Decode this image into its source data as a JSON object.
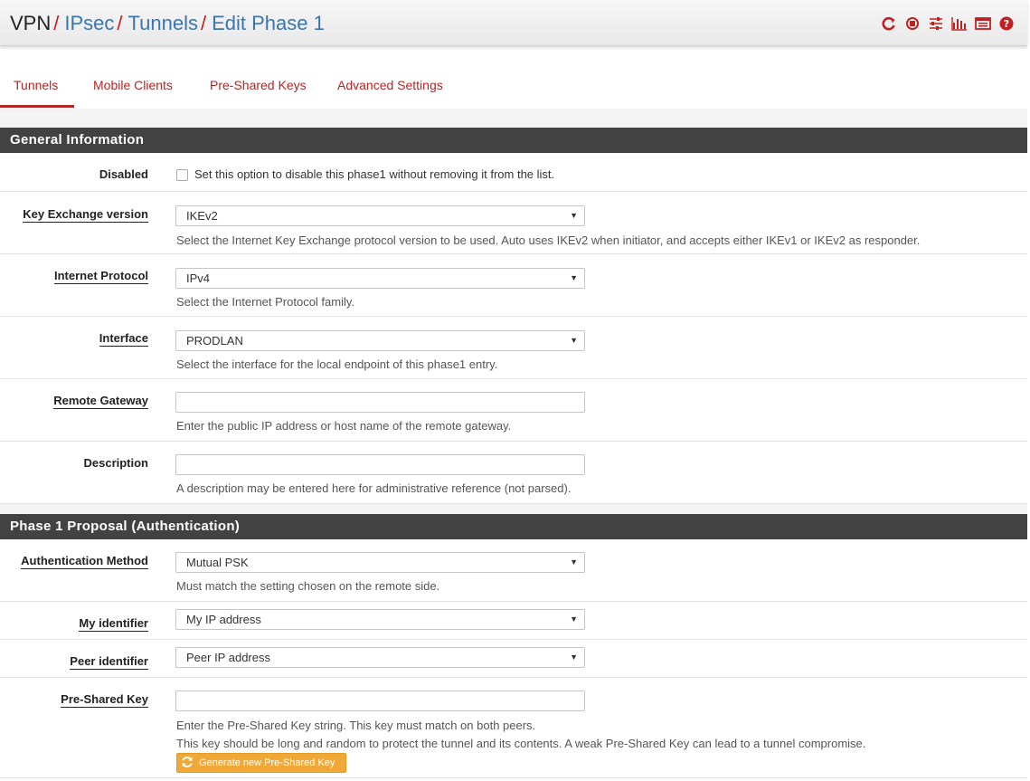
{
  "breadcrumb": {
    "root": "VPN",
    "items": [
      "IPsec",
      "Tunnels",
      "Edit Phase 1"
    ],
    "sep": "/"
  },
  "header_icons": [
    "reload-icon",
    "stop-icon",
    "settings-sliders-icon",
    "bar-chart-icon",
    "list-icon",
    "help-icon"
  ],
  "tabs": [
    "Tunnels",
    "Mobile Clients",
    "Pre-Shared Keys",
    "Advanced Settings"
  ],
  "general": {
    "title": "General Information",
    "disabled_label": "Disabled",
    "disabled_text": "Set this option to disable this phase1 without removing it from the list.",
    "kex_label": "Key Exchange version",
    "kex_value": "IKEv2",
    "kex_help": "Select the Internet Key Exchange protocol version to be used. Auto uses IKEv2 when initiator, and accepts either IKEv1 or IKEv2 as responder.",
    "proto_label": "Internet Protocol",
    "proto_value": "IPv4",
    "proto_help": "Select the Internet Protocol family.",
    "iface_label": "Interface",
    "iface_value": "PRODLAN",
    "iface_help": "Select the interface for the local endpoint of this phase1 entry.",
    "gw_label": "Remote Gateway",
    "gw_value": "",
    "gw_help": "Enter the public IP address or host name of the remote gateway.",
    "desc_label": "Description",
    "desc_value": "",
    "desc_help": "A description may be entered here for administrative reference (not parsed)."
  },
  "phase1": {
    "title": "Phase 1 Proposal (Authentication)",
    "auth_label": "Authentication Method",
    "auth_value": "Mutual PSK",
    "auth_help": "Must match the setting chosen on the remote side.",
    "myid_label": "My identifier",
    "myid_value": "My IP address",
    "peerid_label": "Peer identifier",
    "peerid_value": "Peer IP address",
    "psk_label": "Pre-Shared Key",
    "psk_value": "",
    "psk_help1": "Enter the Pre-Shared Key string. This key must match on both peers.",
    "psk_help2": "This key should be long and random to protect the tunnel and its contents. A weak Pre-Shared Key can lead to a tunnel compromise.",
    "gen_button": "Generate new Pre-Shared Key"
  },
  "colors": {
    "accent": "#b52626",
    "link": "#3a75b0",
    "panel": "#424242",
    "button": "#f0a937"
  }
}
